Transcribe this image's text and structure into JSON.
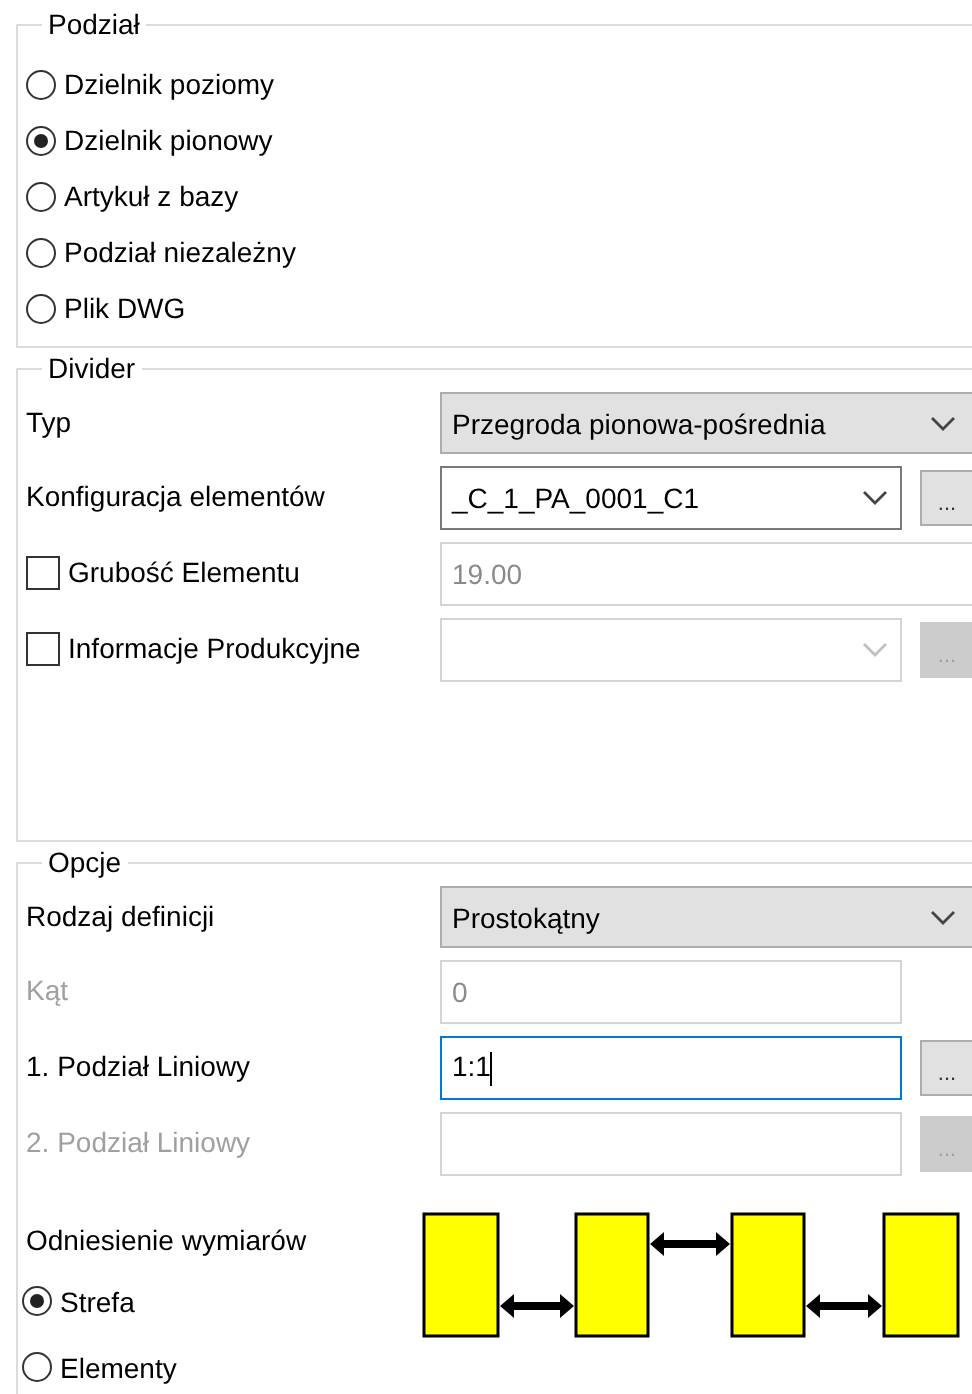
{
  "division": {
    "title": "Podział",
    "options": [
      {
        "label": "Dzielnik poziomy",
        "selected": false
      },
      {
        "label": "Dzielnik pionowy",
        "selected": true
      },
      {
        "label": "Artykuł z bazy",
        "selected": false
      },
      {
        "label": "Podział niezależny",
        "selected": false
      },
      {
        "label": "Plik DWG",
        "selected": false
      }
    ]
  },
  "divider": {
    "title": "Divider",
    "rows": [
      {
        "kind": "select",
        "label": "Typ",
        "value": "Przegroda pionowa-pośrednia"
      },
      {
        "kind": "combo",
        "label": "Konfiguracja elementów",
        "value": "_C_1_PA_0001_C1",
        "button": "...",
        "disabled": false
      },
      {
        "kind": "field",
        "label": "Grubość Elementu",
        "checked": false,
        "value": "19.00",
        "disabled": true
      },
      {
        "kind": "combo",
        "label": "Informacje Produkcyjne",
        "checked": false,
        "button": "...",
        "disabled": true
      }
    ]
  },
  "options": {
    "title": "Opcje",
    "rows": [
      {
        "kind": "select",
        "label": "Rodzaj definicji",
        "value": "Prostokątny"
      },
      {
        "kind": "field",
        "label": "Kąt",
        "value": "0",
        "disabled": true,
        "label_disabled": true
      },
      {
        "kind": "field",
        "label": "1. Podział Liniowy",
        "value": "1:1",
        "focused": true,
        "button": "...",
        "disabled": false
      },
      {
        "kind": "field",
        "label": "2. Podział Liniowy",
        "button": "...",
        "disabled": true,
        "label_disabled": true
      }
    ],
    "reference": {
      "label": "Odniesienie wymiarów",
      "options": [
        {
          "label": "Strefa",
          "selected": true
        },
        {
          "label": "Elementy",
          "selected": false
        }
      ]
    }
  }
}
